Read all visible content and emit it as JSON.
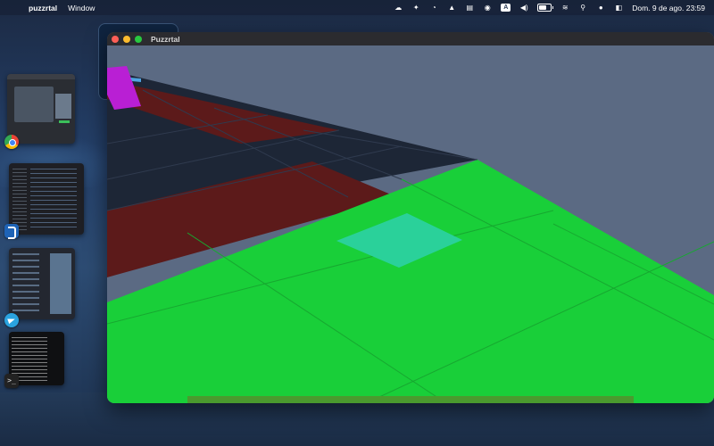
{
  "menubar": {
    "apple_icon": "apple-icon",
    "app_name": "puzzrtal",
    "menus": [
      "Window"
    ],
    "status_icons": [
      "creative-cloud-icon",
      "sparkle-icon",
      "clock-sync-icon",
      "vlc-icon",
      "menu-meter-icon",
      "record-icon",
      "keyboard-input-icon",
      "volume-icon",
      "battery-icon",
      "wifi-icon",
      "search-icon",
      "siri-icon",
      "control-center-icon"
    ],
    "input_badge": "A",
    "datetime": "Dom. 9 de ago.  23:59"
  },
  "window": {
    "title": "Puzzrtal",
    "colors": {
      "sky": "#5b6a83",
      "floor_dark": "#1d2636",
      "floor_red": "#5c1a1a",
      "floor_green": "#19cf39",
      "target_tile": "#2ad19a",
      "avatar": "#b91fd4"
    }
  },
  "dock": {
    "apps": [
      "Google Chrome",
      "Visual Studio Code",
      "Telegram",
      "Terminal"
    ]
  }
}
